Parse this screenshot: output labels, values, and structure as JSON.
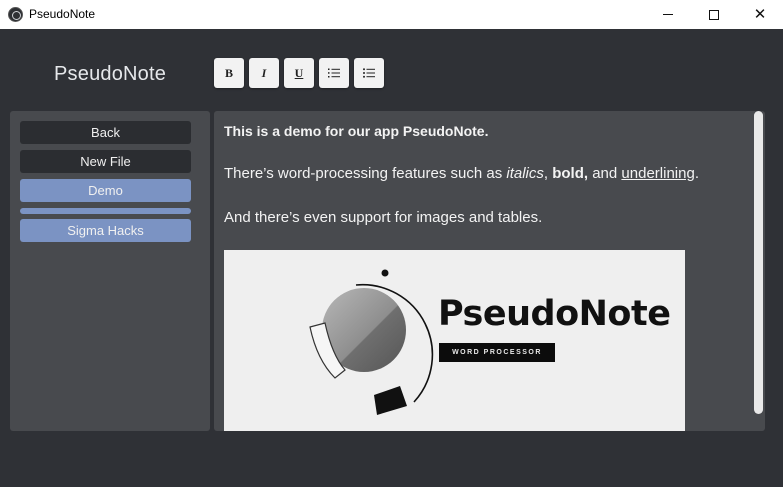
{
  "window": {
    "title": "PseudoNote",
    "minimize_glyph": "",
    "maximize_glyph": "",
    "close_glyph": "✕"
  },
  "header": {
    "brand": "PseudoNote"
  },
  "toolbar": {
    "bold_label": "B",
    "italic_label": "I",
    "underline_label": "U",
    "ordered_list_icon": "ordered-list-icon",
    "bullet_list_icon": "bullet-list-icon"
  },
  "sidebar": {
    "items": [
      {
        "label": "Back",
        "style": "dark"
      },
      {
        "label": "New File",
        "style": "dark"
      },
      {
        "label": "Demo",
        "style": "selected"
      },
      {
        "label": "Sigma Hacks",
        "style": "selected"
      }
    ]
  },
  "editor": {
    "line1": "This is a demo for our app PseudoNote.",
    "line2_prefix": "There’s word-processing features such as ",
    "line2_italic": "italics",
    "line2_sep1": ", ",
    "line2_bold": "bold,",
    "line2_sep2": " and ",
    "line2_underline": "underlining",
    "line2_suffix": ".",
    "line3": "And there’s even support for images and tables.",
    "image": {
      "logo_text": "PseudoNote",
      "logo_subtitle": "WORD PROCESSOR"
    }
  },
  "colors": {
    "app_background": "#2f3136",
    "panel": "#484a4e",
    "accent": "#7b93c3",
    "dark_button": "#2b2d31"
  }
}
